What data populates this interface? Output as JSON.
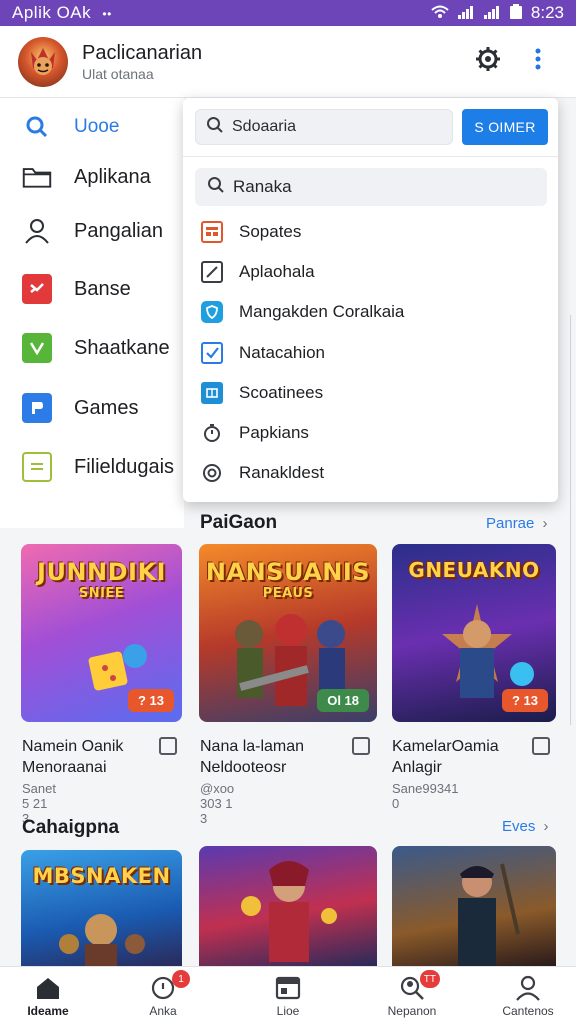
{
  "status_bar": {
    "carrier": "Aplik OAk",
    "dots": "••",
    "time": "8:23"
  },
  "header": {
    "title": "Paclicanarian",
    "subtitle": "Ulat otanaa"
  },
  "sidebar": {
    "items": [
      {
        "label": "Uooe",
        "icon": "search-icon",
        "active": true
      },
      {
        "label": "Aplikana",
        "icon": "folder-icon"
      },
      {
        "label": "Pangalian",
        "icon": "user-icon"
      },
      {
        "label": "Banse",
        "icon": "flag-icon",
        "color": "#e23a3a"
      },
      {
        "label": "Shaatkane",
        "icon": "check-icon",
        "color": "#57b53a"
      },
      {
        "label": "Games",
        "icon": "game-icon",
        "color": "#2d7be6"
      },
      {
        "label": "Filieldugais",
        "icon": "list-icon",
        "color": "#9fbf3a"
      }
    ]
  },
  "dropdown": {
    "search_placeholder": "Sdoaaria",
    "button_label": "S OIMER",
    "sub_search": "Ranaka",
    "items": [
      {
        "label": "Sopates",
        "icon": "grid-icon",
        "color": "#e0572e"
      },
      {
        "label": "Aplaohala",
        "icon": "edit-icon",
        "color": "#3a3d44"
      },
      {
        "label": "Mangakden Coralkaia",
        "icon": "shield-icon",
        "color": "#1ea0e0"
      },
      {
        "label": "Natacahion",
        "icon": "checkbox-icon",
        "color": "#2a7be6"
      },
      {
        "label": "Scoatinees",
        "icon": "window-icon",
        "color": "#1e8fd6"
      },
      {
        "label": "Papkians",
        "icon": "clock-icon",
        "color": "#3a3d44"
      },
      {
        "label": "Ranakldest",
        "icon": "target-icon",
        "color": "#3a3d44"
      }
    ]
  },
  "section1": {
    "title": "PaiGaon",
    "link": "Panrae",
    "cards": [
      {
        "logo": "JUNNDIKI",
        "logo_sub": "SNIEE",
        "badge": "? 13",
        "badge_color": "#e8562c",
        "name1": "Namein Oanik",
        "name2": "Menoraanai",
        "meta": "Sanet 5 21 3"
      },
      {
        "logo": "NANSUANIS",
        "logo_sub": "PEAUS",
        "badge": "Ol 18",
        "badge_color": "#3d8a4a",
        "name1": "Nana la-laman",
        "name2": "Neldooteosr",
        "meta": "@xoo 303 1 3"
      },
      {
        "logo": "GNEUAKNO",
        "logo_sub": "",
        "badge": "? 13",
        "badge_color": "#e8562c",
        "name1": "KamelarOamia",
        "name2": "Anlagir",
        "meta": "Sane99341 0"
      }
    ]
  },
  "section2": {
    "title": "Cahaigpna",
    "link": "Eves",
    "cards": [
      {
        "logo": "MBSNAKEN",
        "logo_sub": ""
      },
      {
        "logo": "",
        "logo_sub": ""
      },
      {
        "logo": "",
        "logo_sub": ""
      }
    ]
  },
  "bottom_nav": [
    {
      "label": "Ideame",
      "icon": "home-icon",
      "active": true
    },
    {
      "label": "Anka",
      "icon": "notifications-icon",
      "badge": "1"
    },
    {
      "label": "Lioe",
      "icon": "window-icon"
    },
    {
      "label": "Nepanon",
      "icon": "search-people-icon",
      "badge": "TT"
    },
    {
      "label": "Cantenos",
      "icon": "profile-icon"
    }
  ]
}
